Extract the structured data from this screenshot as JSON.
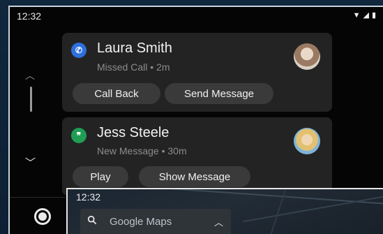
{
  "status": {
    "time": "12:32",
    "icons": [
      "wifi-icon",
      "signal-icon",
      "battery-icon"
    ]
  },
  "rail": {
    "icons": [
      "chevron-up-icon",
      "scrollbar",
      "chevron-down-icon",
      "home-icon"
    ]
  },
  "notifications": [
    {
      "app_icon": "phone-icon",
      "app_color": "#2f6fde",
      "name": "Laura Smith",
      "detail": "Missed Call • 2m",
      "actions": [
        "Call Back",
        "Send Message"
      ]
    },
    {
      "app_icon": "hangouts-icon",
      "app_color": "#1f9d55",
      "name": "Jess Steele",
      "detail": "New Message • 30m",
      "actions": [
        "Play",
        "Show Message"
      ]
    }
  ],
  "map": {
    "time": "12:32",
    "search_placeholder": "Google Maps"
  }
}
